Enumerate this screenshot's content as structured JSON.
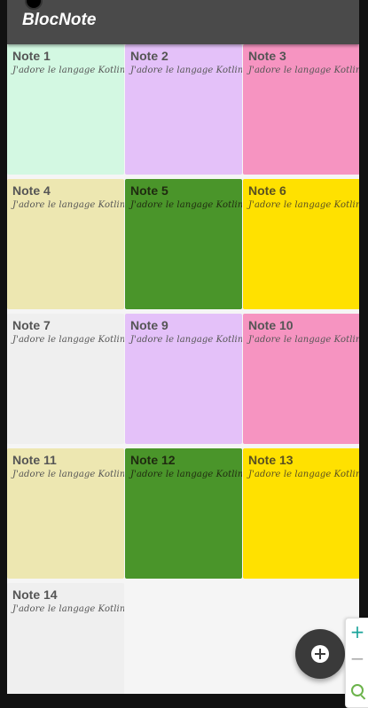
{
  "app": {
    "title": "BlocNote"
  },
  "notes": [
    {
      "title": "Note 1",
      "body": "J'adore le langage Kotlin",
      "color": "#d3f8e2"
    },
    {
      "title": "Note 2",
      "body": "J'adore le langage Kotlin",
      "color": "#e4c1f9"
    },
    {
      "title": "Note 3",
      "body": "J'adore le langage Kotlin",
      "color": "#f694c1"
    },
    {
      "title": "Note 4",
      "body": "J'adore le langage Kotlin",
      "color": "#ede7b1"
    },
    {
      "title": "Note 5",
      "body": "J'adore le langage Kotlin",
      "color": "#4a952a"
    },
    {
      "title": "Note 6",
      "body": "J'adore le langage Kotlin",
      "color": "#ffe100"
    },
    {
      "title": "Note 7",
      "body": "J'adore le langage Kotlin",
      "color": "#efefef"
    },
    {
      "title": "Note 9",
      "body": "J'adore le langage Kotlin",
      "color": "#e4c1f9"
    },
    {
      "title": "Note 10",
      "body": "J'adore le langage Kotlin",
      "color": "#f694c1"
    },
    {
      "title": "Note 11",
      "body": "J'adore le langage Kotlin",
      "color": "#ede7b1"
    },
    {
      "title": "Note 12",
      "body": "J'adore le langage Kotlin",
      "color": "#4a952a"
    },
    {
      "title": "Note 13",
      "body": "J'adore le langage Kotlin",
      "color": "#ffe100"
    },
    {
      "title": "Note 14",
      "body": "J'adore le langage Kotlin",
      "color": "#efefef"
    }
  ],
  "fab": {
    "icon": "add-circle-icon"
  },
  "zoom": {
    "zoom_in": "+",
    "zoom_out": "−",
    "search_icon": "magnifier-icon"
  }
}
